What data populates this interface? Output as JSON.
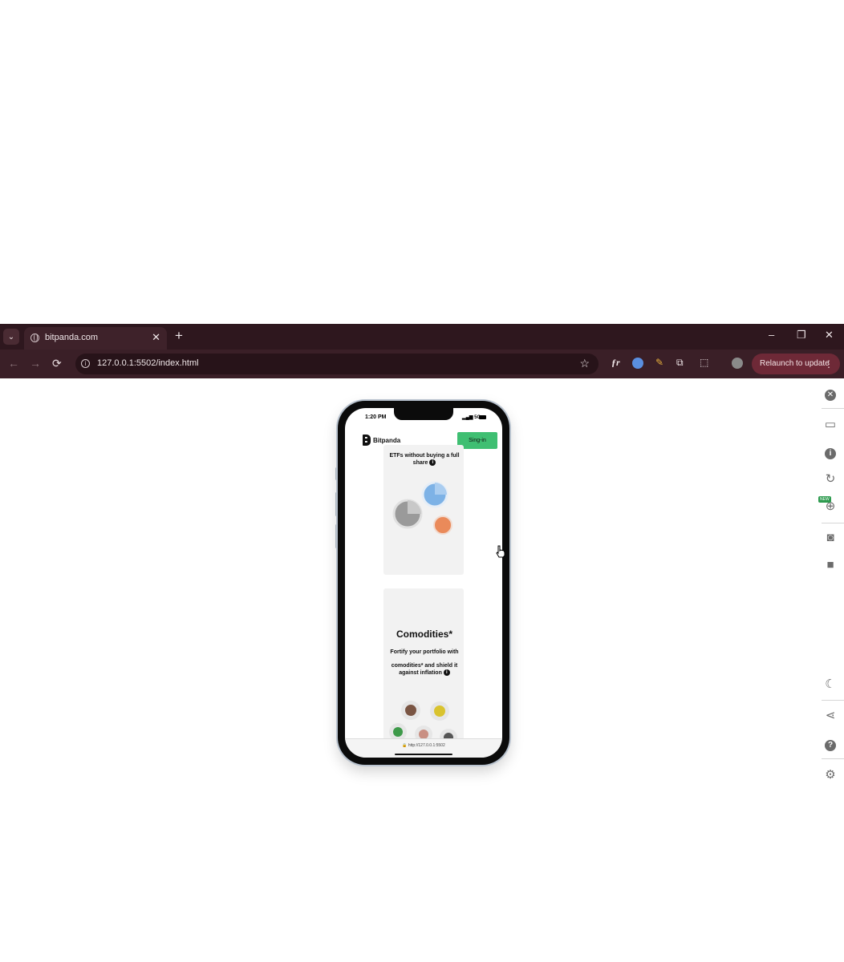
{
  "browser": {
    "tab_title": "bitpanda.com",
    "tab_close": "✕",
    "new_tab": "+",
    "window_controls": [
      "–",
      "❐",
      "✕"
    ],
    "url": "127.0.0.1:5502/index.html",
    "relaunch_label": "Relaunch to update",
    "relaunch_menu": "⋮"
  },
  "phone": {
    "status_time": "1:20 PM",
    "status_network": "5G",
    "brand": "Bitpanda",
    "signin_label": "Sing-in",
    "etf_text": "ETFs without buying a full share",
    "commodities_title": "Comodities*",
    "commodities_desc_1": "Fortify your portfolio with",
    "commodities_desc_2": "comodities* and shield it against inflation",
    "bottom_url": "http://127.0.0.1:5502"
  },
  "colors": {
    "tab_bar": "#2e171e",
    "toolbar": "#3a1f27",
    "relaunch": "#6e2937",
    "signin": "#3fbf72",
    "card": "#f2f2f2"
  },
  "side_panel_icons": [
    "close-icon",
    "devices-icon",
    "info-icon",
    "rotate-icon",
    "zoom-new-icon",
    "camera-icon",
    "video-icon",
    "moon-icon",
    "share-icon",
    "help-icon",
    "settings-icon"
  ]
}
